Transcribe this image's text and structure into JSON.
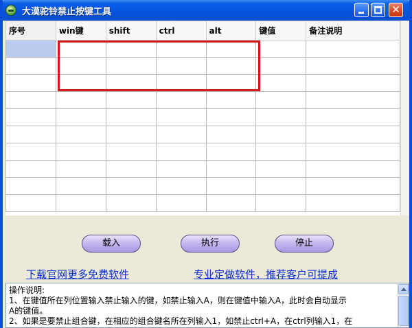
{
  "window": {
    "title": "大漠驼铃禁止按键工具",
    "titlebar_color": "#0a5ee8"
  },
  "grid": {
    "columns": [
      "序号",
      "win键",
      "shift",
      "ctrl",
      "alt",
      "键值",
      "备注说明"
    ],
    "row_count": 10,
    "selected_cell": "row-1-col-1"
  },
  "buttons": {
    "load": "载入",
    "run": "执行",
    "stop": "停止"
  },
  "links": {
    "download": "下载官网更多免费软件",
    "custom": "专业定做软件，推荐客户可提成"
  },
  "instructions": {
    "lines": [
      "操作说明:",
      "1、在键值所在列位置输入禁止输入的键，如禁止输入A，则在键值中输入A，此时会自动显示",
      "A的键值。",
      "2、如果是要禁止组合键，在相应的组合键名所在列输入1，如禁止ctrl+A，在ctrl列输入1，在"
    ]
  }
}
